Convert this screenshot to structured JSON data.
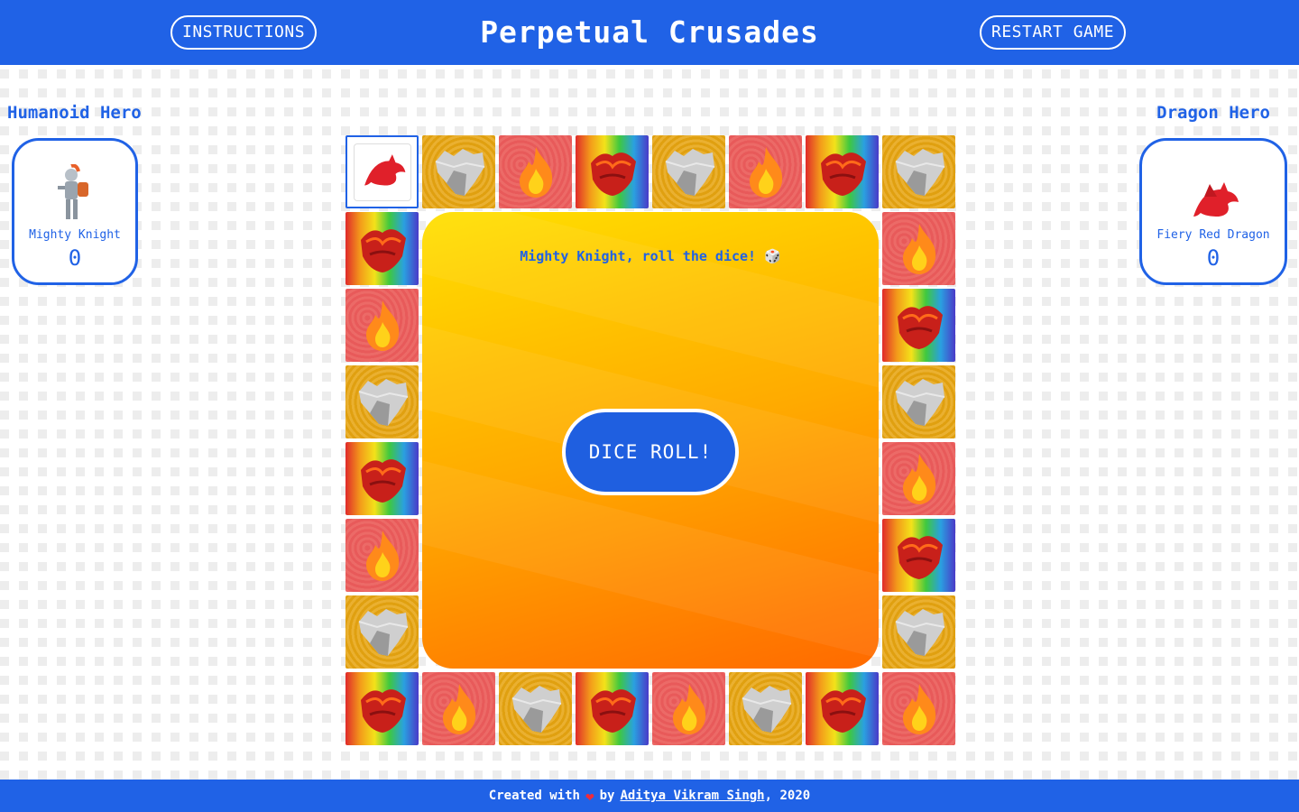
{
  "header": {
    "title": "Perpetual Crusades",
    "instructions_label": "INSTRUCTIONS",
    "restart_label": "RESTART GAME",
    "color": "#2062e6"
  },
  "players": {
    "human": {
      "heading": "Humanoid Hero",
      "name": "Mighty Knight",
      "score": "0",
      "icon": "knight-icon"
    },
    "dragon": {
      "heading": "Dragon Hero",
      "name": "Fiery Red Dragon",
      "score": "0",
      "icon": "dragon-icon"
    }
  },
  "game": {
    "prompt": "Mighty Knight, roll the dice! 🎲",
    "dice_label": "DICE ROLL!",
    "top_row": [
      "start",
      "rock",
      "fire",
      "lava",
      "rock",
      "fire",
      "lava",
      "rock"
    ],
    "right_col": [
      "fire",
      "lava",
      "rock",
      "fire",
      "lava",
      "rock"
    ],
    "bottom_row": [
      "lava",
      "fire",
      "rock",
      "lava",
      "fire",
      "rock",
      "lava",
      "fire"
    ],
    "left_col": [
      "lava",
      "fire",
      "rock",
      "lava",
      "fire",
      "rock"
    ]
  },
  "footer": {
    "prefix": "Created with",
    "by": "by",
    "author": "Aditya Vikram Singh",
    "year": ", 2020"
  }
}
